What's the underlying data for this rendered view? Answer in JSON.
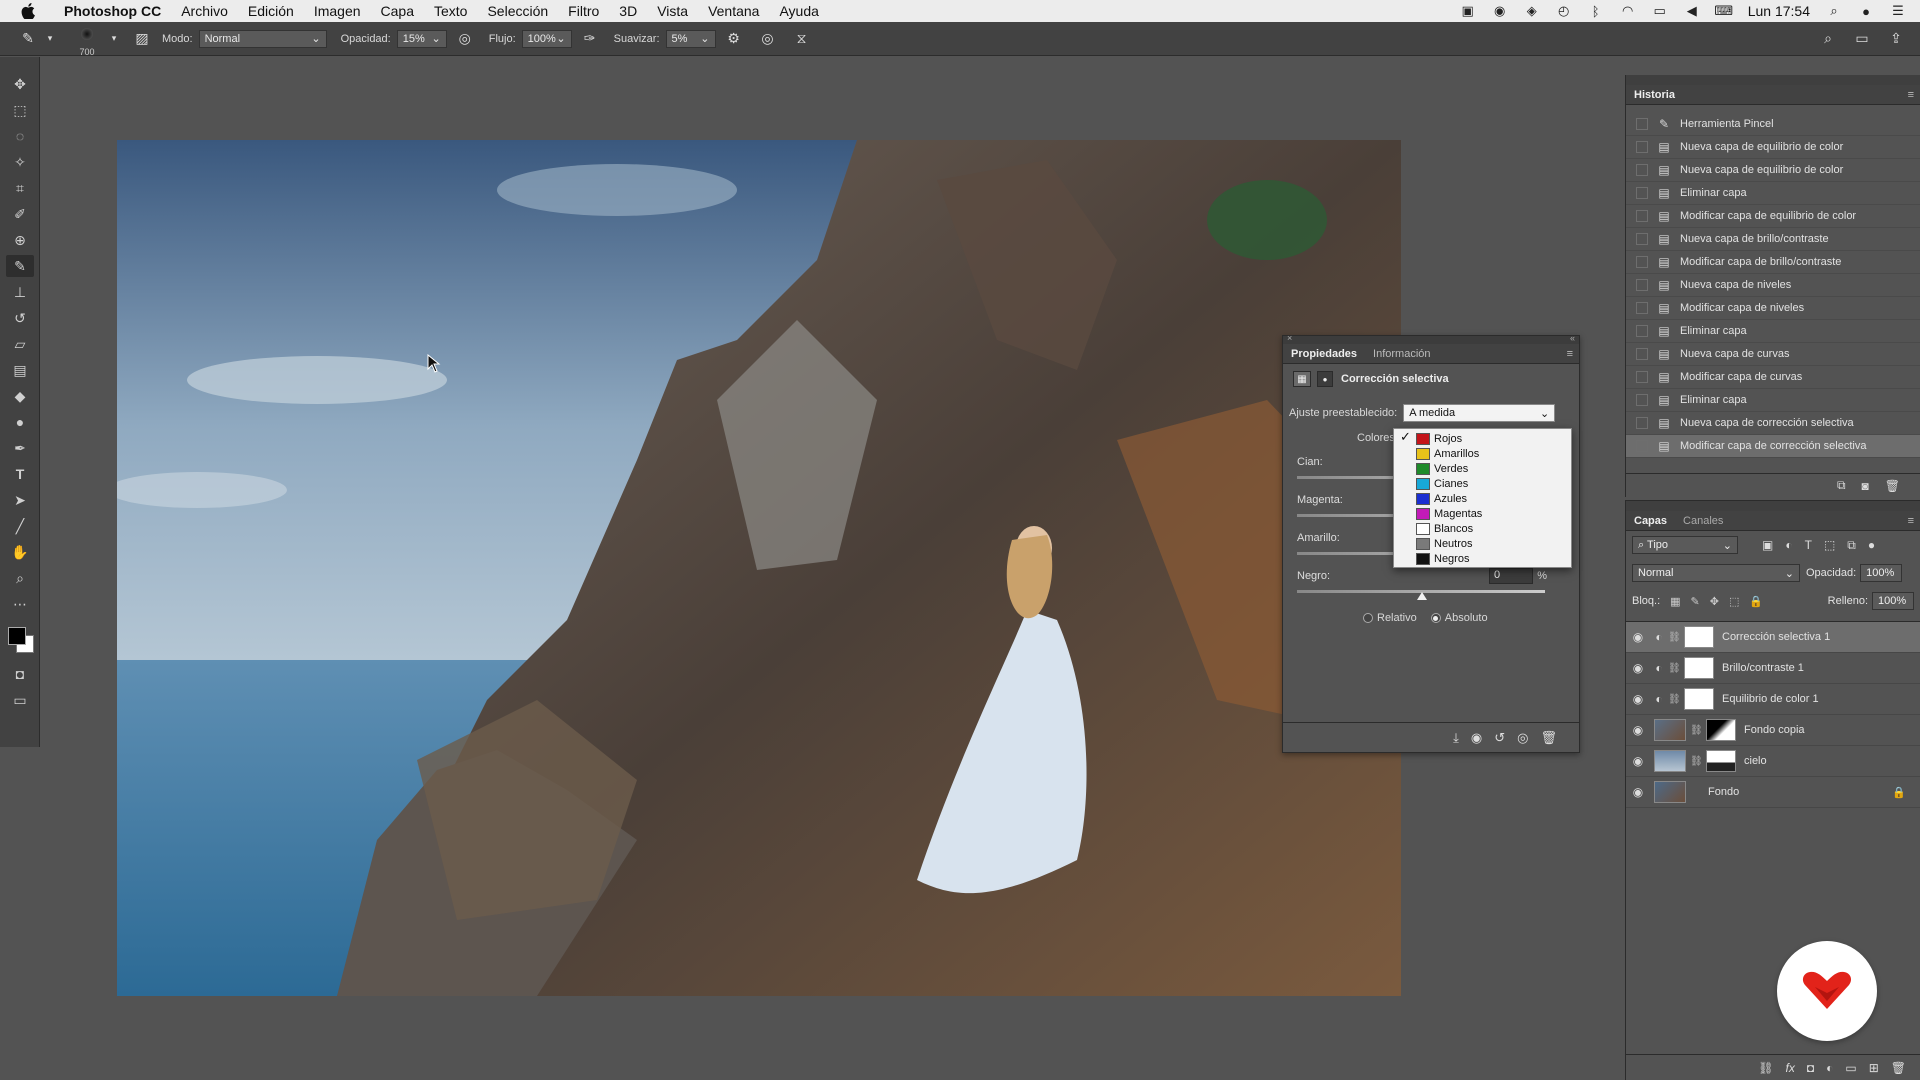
{
  "menubar": {
    "app": "Photoshop CC",
    "items": [
      "Archivo",
      "Edición",
      "Imagen",
      "Capa",
      "Texto",
      "Selección",
      "Filtro",
      "3D",
      "Vista",
      "Ventana",
      "Ayuda"
    ],
    "clock": "Lun 17:54"
  },
  "options": {
    "brush_size": "700",
    "mode_label": "Modo:",
    "mode_value": "Normal",
    "opacity_label": "Opacidad:",
    "opacity_value": "15%",
    "flow_label": "Flujo:",
    "flow_value": "100%",
    "smooth_label": "Suavizar:",
    "smooth_value": "5%"
  },
  "properties": {
    "tabs": [
      "Propiedades",
      "Información"
    ],
    "title": "Corrección selectiva",
    "preset_label": "Ajuste preestablecido:",
    "preset_value": "A medida",
    "colors_label": "Colores:",
    "sliders": [
      {
        "label": "Cian:",
        "value": ""
      },
      {
        "label": "Magenta:",
        "value": ""
      },
      {
        "label": "Amarillo:",
        "value": ""
      },
      {
        "label": "Negro:",
        "value": "0"
      }
    ],
    "percent": "%",
    "radio_relative": "Relativo",
    "radio_absolute": "Absoluto",
    "selected_method": "Absoluto"
  },
  "color_options": [
    {
      "label": "Rojos",
      "color": "#c4141a",
      "checked": true
    },
    {
      "label": "Amarillos",
      "color": "#e8c21a",
      "checked": false
    },
    {
      "label": "Verdes",
      "color": "#1f8a2a",
      "checked": false
    },
    {
      "label": "Cianes",
      "color": "#18a8d8",
      "checked": false
    },
    {
      "label": "Azules",
      "color": "#1b2fd1",
      "checked": false
    },
    {
      "label": "Magentas",
      "color": "#c21bb7",
      "checked": false
    },
    {
      "label": "Blancos",
      "color": "#ffffff",
      "checked": false
    },
    {
      "label": "Neutros",
      "color": "#7a7a7a",
      "checked": false
    },
    {
      "label": "Negros",
      "color": "#111111",
      "checked": false
    }
  ],
  "history": {
    "title": "Historia",
    "items": [
      "Herramienta Pincel",
      "Nueva capa de equilibrio de color",
      "Nueva capa de equilibrio de color",
      "Eliminar capa",
      "Modificar capa de equilibrio de color",
      "Nueva capa de brillo/contraste",
      "Modificar capa de brillo/contraste",
      "Nueva capa de niveles",
      "Modificar capa de niveles",
      "Eliminar capa",
      "Nueva capa de curvas",
      "Modificar capa de curvas",
      "Eliminar capa",
      "Nueva capa de corrección selectiva",
      "Modificar capa de corrección selectiva"
    ]
  },
  "layers": {
    "tabs": [
      "Capas",
      "Canales"
    ],
    "filter": "Tipo",
    "blend_mode": "Normal",
    "opacity_label": "Opacidad:",
    "opacity_value": "100%",
    "lock_label": "Bloq.:",
    "fill_label": "Relleno:",
    "fill_value": "100%",
    "items": [
      {
        "name": "Corrección selectiva 1",
        "kind": "adjustment",
        "selected": true
      },
      {
        "name": "Brillo/contraste 1",
        "kind": "adjustment",
        "selected": false
      },
      {
        "name": "Equilibrio de color 1",
        "kind": "adjustment",
        "selected": false
      },
      {
        "name": "Fondo copia",
        "kind": "masked",
        "selected": false
      },
      {
        "name": "cielo",
        "kind": "masked",
        "selected": false
      },
      {
        "name": "Fondo",
        "kind": "locked",
        "selected": false
      }
    ]
  }
}
